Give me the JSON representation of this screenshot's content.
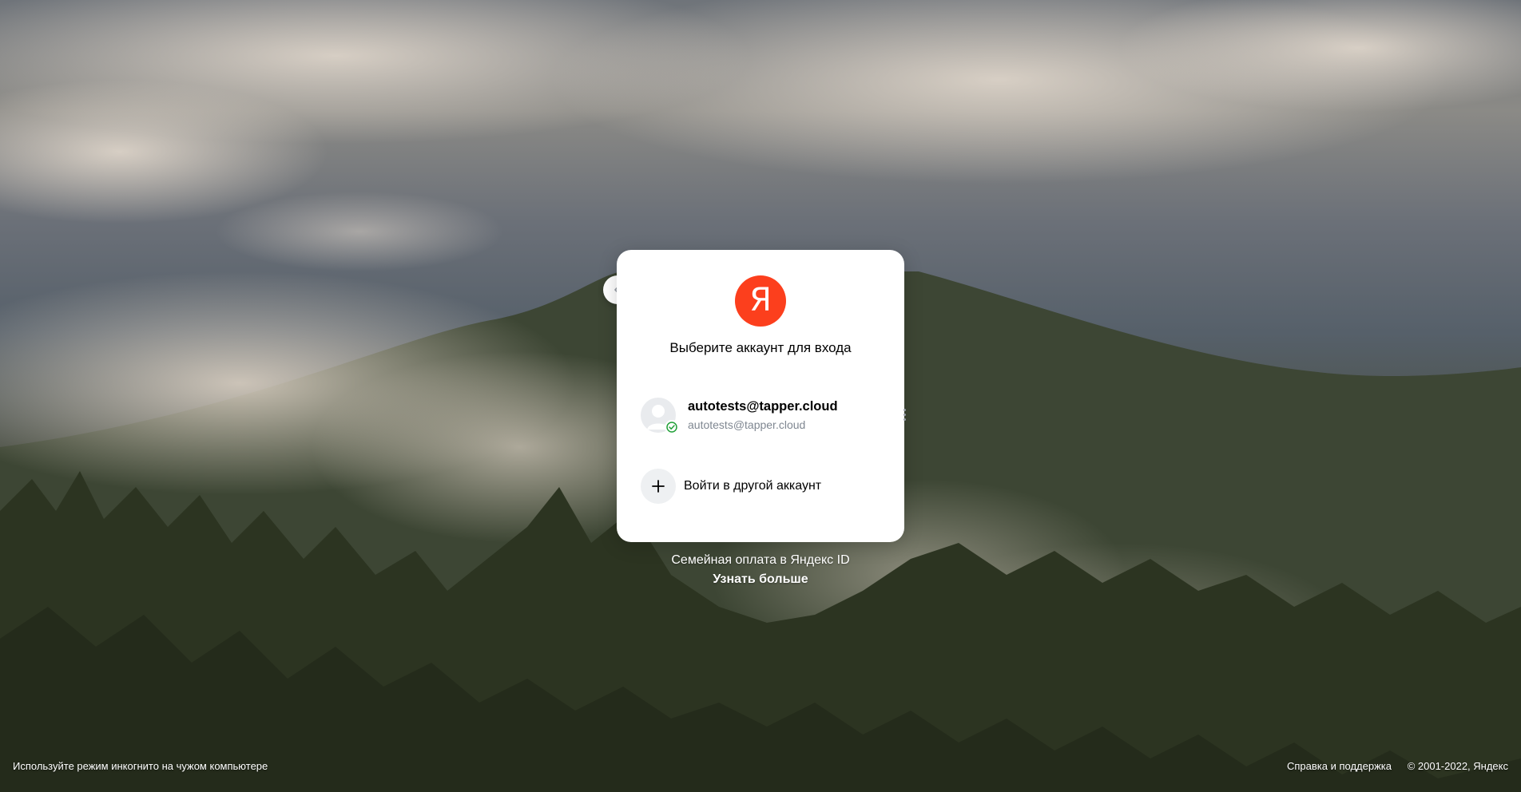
{
  "background": {
    "sky_color": "#6b7078",
    "forest_color": "#2d3522",
    "mist_color": "#d8d0c6"
  },
  "card": {
    "logo_letter": "Я",
    "logo_color": "#fc3f1d",
    "title": "Выберите аккаунт для входа",
    "account": {
      "display_name": "autotests@tapper.cloud",
      "email": "autotests@tapper.cloud",
      "avatar_icon": "default-avatar-icon",
      "status_icon": "verified-check-icon",
      "status_color": "#21a038"
    },
    "more_icon": "vertical-dots-icon",
    "add_account": {
      "icon": "plus-icon",
      "label": "Войти в другой аккаунт"
    },
    "back_icon": "chevron-left-icon"
  },
  "promo": {
    "text": "Семейная оплата в Яндекс ID",
    "link": "Узнать больше"
  },
  "footer": {
    "incognito_hint": "Используйте режим инкогнито на чужом компьютере",
    "help_link": "Справка и поддержка",
    "copyright": "© 2001-2022, Яндекс"
  }
}
